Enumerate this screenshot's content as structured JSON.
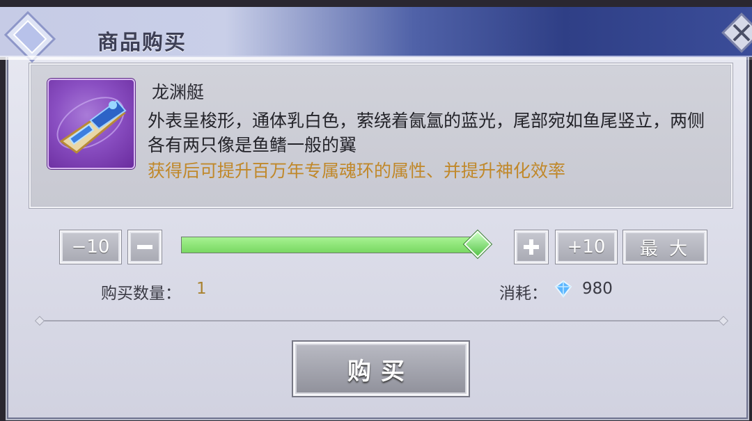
{
  "dialog": {
    "title": "商品购买",
    "close_icon": "close-x-icon"
  },
  "item": {
    "name": "龙渊艇",
    "description": "外表呈梭形，通体乳白色，萦绕着氤氲的蓝光，尾部宛如鱼尾竖立，两侧各有两只像是鱼鳍一般的翼",
    "effect": "获得后可提升百万年专属魂环的属性、并提升神化效率",
    "icon": "boat-icon"
  },
  "quantity_controls": {
    "minus10_label": "−10",
    "minus_icon": "minus-icon",
    "plus_icon": "plus-icon",
    "plus10_label": "+10",
    "max_label": "最 大",
    "slider_fill_fraction": 1.0
  },
  "summary": {
    "quantity_label": "购买数量：",
    "quantity_value": "1",
    "cost_label": "消耗：",
    "cost_icon": "diamond-gem-icon",
    "cost_value": "980"
  },
  "buy_button": {
    "label": "购买"
  },
  "colors": {
    "effect_text": "#c0882a",
    "slider_green": "#8fe87a",
    "title_blue": "#2f3f86"
  }
}
